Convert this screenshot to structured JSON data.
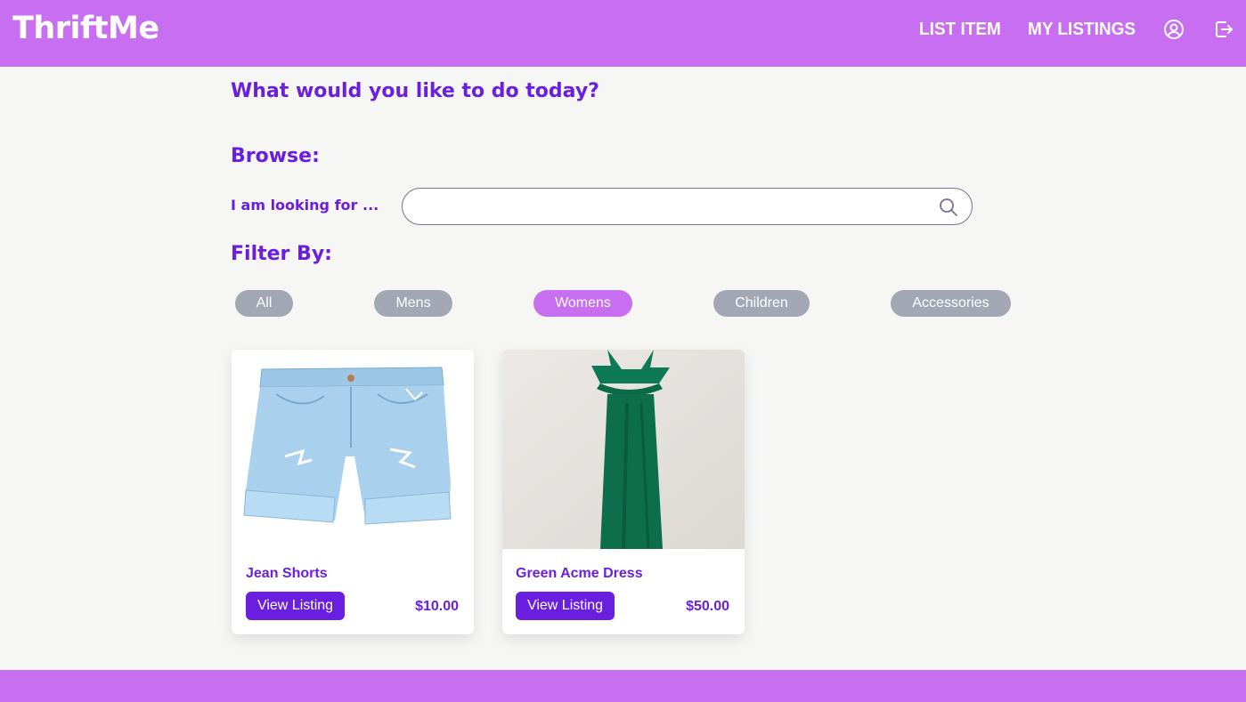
{
  "header": {
    "logo": "ThriftMe",
    "nav": [
      {
        "label": "LIST ITEM"
      },
      {
        "label": "MY LISTINGS"
      }
    ],
    "icons": [
      "user-circle-icon",
      "logout-icon"
    ]
  },
  "main": {
    "greeting": "What would you like to do today?",
    "browse_title": "Browse:",
    "search": {
      "label": "I am looking for ...",
      "value": "",
      "placeholder": ""
    },
    "filter_title": "Filter By:",
    "filters": [
      {
        "label": "All",
        "active": false
      },
      {
        "label": "Mens",
        "active": false
      },
      {
        "label": "Womens",
        "active": true
      },
      {
        "label": "Children",
        "active": false
      },
      {
        "label": "Accessories",
        "active": false
      }
    ],
    "listings": [
      {
        "name": "Jean Shorts",
        "button": "View Listing",
        "price": "$10.00"
      },
      {
        "name": "Green Acme Dress",
        "button": "View Listing",
        "price": "$50.00"
      }
    ]
  },
  "colors": {
    "brand": "#c76ff0",
    "accent": "#6a1fe0",
    "pill_inactive": "#a2a8b3",
    "background": "#f6f6f4"
  }
}
